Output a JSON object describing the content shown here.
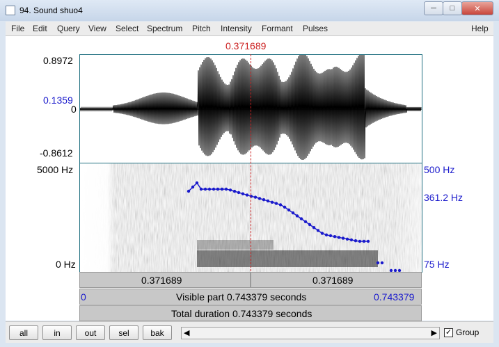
{
  "window": {
    "title": "94. Sound shuo4"
  },
  "menu": [
    "File",
    "Edit",
    "Query",
    "View",
    "Select",
    "Spectrum",
    "Pitch",
    "Intensity",
    "Formant",
    "Pulses"
  ],
  "menu_help": "Help",
  "cursor": {
    "time_label": "0.371689",
    "left_label": "0.371689",
    "right_label": "0.371689"
  },
  "wave": {
    "max_label": "0.8972",
    "zero_label": "0",
    "min_label": "-0.8612",
    "cursor_value_label": "0.1359"
  },
  "spectrogram": {
    "top_freq": "5000 Hz",
    "bottom_freq": "0 Hz"
  },
  "pitch": {
    "top": "500 Hz",
    "cursor": "361.2 Hz",
    "bottom": "75 Hz"
  },
  "visible": {
    "start": "0",
    "label": "Visible part 0.743379 seconds",
    "end": "0.743379"
  },
  "total": {
    "label": "Total duration 0.743379 seconds"
  },
  "buttons": {
    "all": "all",
    "in": "in",
    "out": "out",
    "sel": "sel",
    "bak": "bak"
  },
  "group": {
    "label": "Group",
    "checked": true
  },
  "colors": {
    "pitch": "#1a1acc",
    "cursor": "#cc2222",
    "frame": "#1f6f80"
  }
}
